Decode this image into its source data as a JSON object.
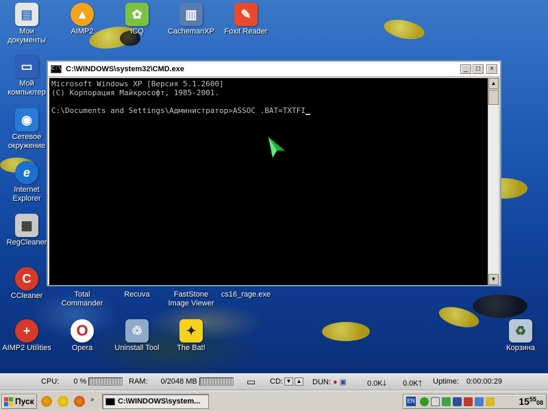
{
  "desktop": {
    "icons": [
      {
        "label": "Мои документы",
        "icon": "my-documents-icon",
        "color": "#e6e6e6"
      },
      {
        "label": "AIMP2",
        "icon": "aimp2-icon",
        "color": "#f2a31c"
      },
      {
        "label": "ICQ",
        "icon": "icq-icon",
        "color": "#7cc242"
      },
      {
        "label": "CachemanXP",
        "icon": "cachemanxp-icon",
        "color": "#5b7cb0"
      },
      {
        "label": "Foxit Reader",
        "icon": "foxit-reader-icon",
        "color": "#e94a2c"
      },
      {
        "label": "Мой компьютер",
        "icon": "my-computer-icon",
        "color": "#2f5fb8"
      },
      {
        "label": "Сетевое окружение",
        "icon": "network-places-icon",
        "color": "#2a7ad8"
      },
      {
        "label": "Internet Explorer",
        "icon": "internet-explorer-icon",
        "color": "#1d6fd0"
      },
      {
        "label": "RegCleaner",
        "icon": "regcleaner-icon",
        "color": "#c9c9c9"
      },
      {
        "label": "CCleaner",
        "icon": "ccleaner-icon",
        "color": "#d83a2a"
      },
      {
        "label": "Total Commander",
        "icon": "total-commander-icon",
        "color": "#3d5fa8"
      },
      {
        "label": "Recuva",
        "icon": "recuva-icon",
        "color": "#caa13a"
      },
      {
        "label": "FastStone Image Viewer",
        "icon": "faststone-icon",
        "color": "#3a6fbf"
      },
      {
        "label": "cs16_rage.exe",
        "icon": "cs16-exe-icon",
        "color": "#5a5a5a"
      },
      {
        "label": "AIMP2 Utilities",
        "icon": "aimp2-utilities-icon",
        "color": "#d63a2a"
      },
      {
        "label": "Opera",
        "icon": "opera-icon",
        "color": "#d61e1e"
      },
      {
        "label": "Uninstall Tool",
        "icon": "uninstall-tool-icon",
        "color": "#8fa9c9"
      },
      {
        "label": "The Bat!",
        "icon": "the-bat-icon",
        "color": "#f4d21e"
      },
      {
        "label": "Корзина",
        "icon": "recycle-bin-icon",
        "color": "#b8c6d6"
      }
    ]
  },
  "cmd_window": {
    "title": "C:\\WINDOWS\\system32\\CMD.exe",
    "icon_text": "C:\\",
    "minimize": "_",
    "maximize": "□",
    "close": "×",
    "lines": [
      "Microsoft Windows XP [Версия 5.1.2600]",
      "(С) Корпорация Майкрософт, 1985-2001.",
      "",
      "C:\\Documents and Settings\\Администратор>ASSOC .BAT=TXTFI"
    ],
    "scroll_up": "▲",
    "scroll_down": "▼"
  },
  "monitor_bar": {
    "cpu_label": "CPU:",
    "cpu_value": "0 %",
    "ram_label": "RAM:",
    "ram_value": "0/2048 MB",
    "cd_label": "CD:",
    "dun_label": "DUN:",
    "down_speed": "0.0K",
    "up_speed": "0.0K",
    "uptime_label": "Uptime:",
    "uptime_value": "0:00:00:29"
  },
  "taskbar": {
    "start_label": "Пуск",
    "task_cmd_label": "C:\\WINDOWS\\system...",
    "lang": "EN",
    "clock_hours": "15",
    "clock_minutes": "55",
    "clock_seconds": "08"
  }
}
